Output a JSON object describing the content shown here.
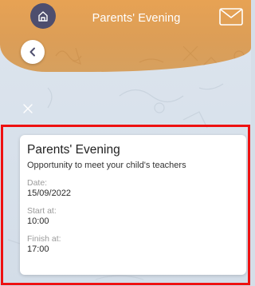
{
  "header": {
    "title": "Parents' Evening",
    "home_icon": "home-icon",
    "mail_icon": "envelope-icon",
    "accent_color": "#e0a057"
  },
  "navigation": {
    "back_icon": "chevron-left-icon",
    "close_icon": "close-icon"
  },
  "event": {
    "title": "Parents' Evening",
    "description": "Opportunity to meet your child's teachers",
    "fields": [
      {
        "label": "Date:",
        "value": "15/09/2022"
      },
      {
        "label": "Start at:",
        "value": "10:00"
      },
      {
        "label": "Finish at:",
        "value": "17:00"
      }
    ]
  },
  "highlight_color": "#ee1111"
}
